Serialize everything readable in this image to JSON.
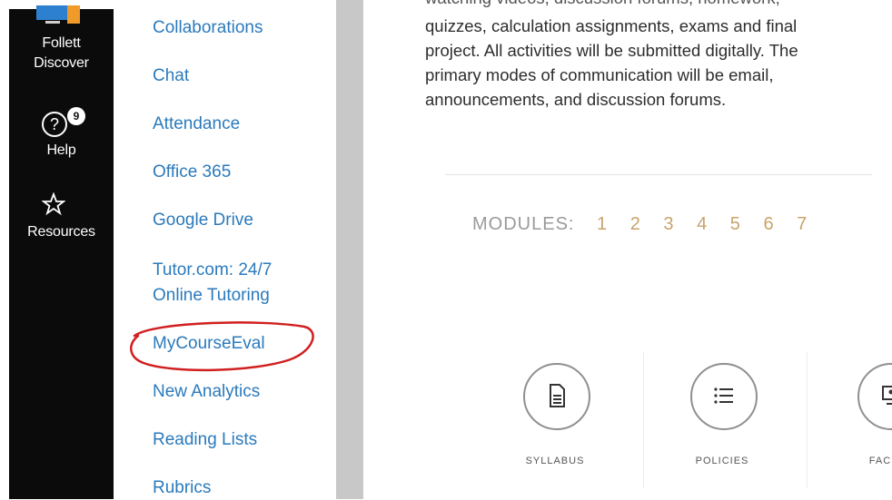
{
  "global_nav": {
    "follett_label_1": "Follett",
    "follett_label_2": "Discover",
    "help_label": "Help",
    "help_badge": "9",
    "resources_label": "Resources"
  },
  "course_nav": {
    "items": [
      {
        "label": "Collaborations"
      },
      {
        "label": "Chat"
      },
      {
        "label": "Attendance"
      },
      {
        "label": "Office 365"
      },
      {
        "label": "Google Drive"
      },
      {
        "label": "Tutor.com: 24/7"
      },
      {
        "label": "Online Tutoring"
      },
      {
        "label": "MyCourseEval"
      },
      {
        "label": "New Analytics"
      },
      {
        "label": "Reading Lists"
      },
      {
        "label": "Rubrics"
      }
    ],
    "highlight_color": "#d11f1f"
  },
  "content": {
    "lines": [
      "watching videos, discussion forums, homework,",
      "quizzes, calculation assignments, exams and final",
      "project. All activities will be submitted digitally. The",
      "primary modes of communication will be email,",
      "announcements, and discussion forums."
    ],
    "modules_label": "MODULES:",
    "modules": [
      "1",
      "2",
      "3",
      "4",
      "5",
      "6",
      "7"
    ],
    "tiles": [
      {
        "caption": "SYLLABUS",
        "icon": "document-icon"
      },
      {
        "caption": "POLICIES",
        "icon": "list-icon"
      },
      {
        "caption": "FAC",
        "icon": "faculty-icon"
      }
    ]
  },
  "colors": {
    "link": "#2b7abc",
    "module_number": "#c9a36b",
    "nav_bg": "#0b0b0b"
  }
}
